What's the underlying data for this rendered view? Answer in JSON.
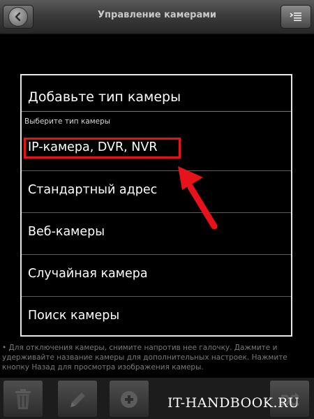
{
  "header": {
    "title": "Управление камерами",
    "back_icon": "back-arrow-icon",
    "menu_icon": "menu-list-icon"
  },
  "dialog": {
    "title": "Добавьте тип камеры",
    "subtitle": "Выберите тип камеры",
    "options": [
      {
        "label": "IP-камера, DVR, NVR",
        "highlighted": true
      },
      {
        "label": "Стандартный адрес"
      },
      {
        "label": "Веб-камеры"
      },
      {
        "label": "Случайная камера"
      },
      {
        "label": "Поиск камеры"
      }
    ],
    "highlight_color": "#e8121b"
  },
  "help_text": "• Для отключения камеры, снимите напротив нее галочку. Дажмите и удерживайте название камеры для дополнительных настроек. Нажмите кнопку Назад для просмотра изображения камеры.",
  "bottom_bar": {
    "buttons": [
      "trash-icon",
      "pencil-icon",
      "add-icon",
      "shuffle-icon"
    ]
  },
  "watermark": "IT-HANDBOOK.RU",
  "colors": {
    "background": "#000000",
    "accent_red": "#e8121b"
  }
}
